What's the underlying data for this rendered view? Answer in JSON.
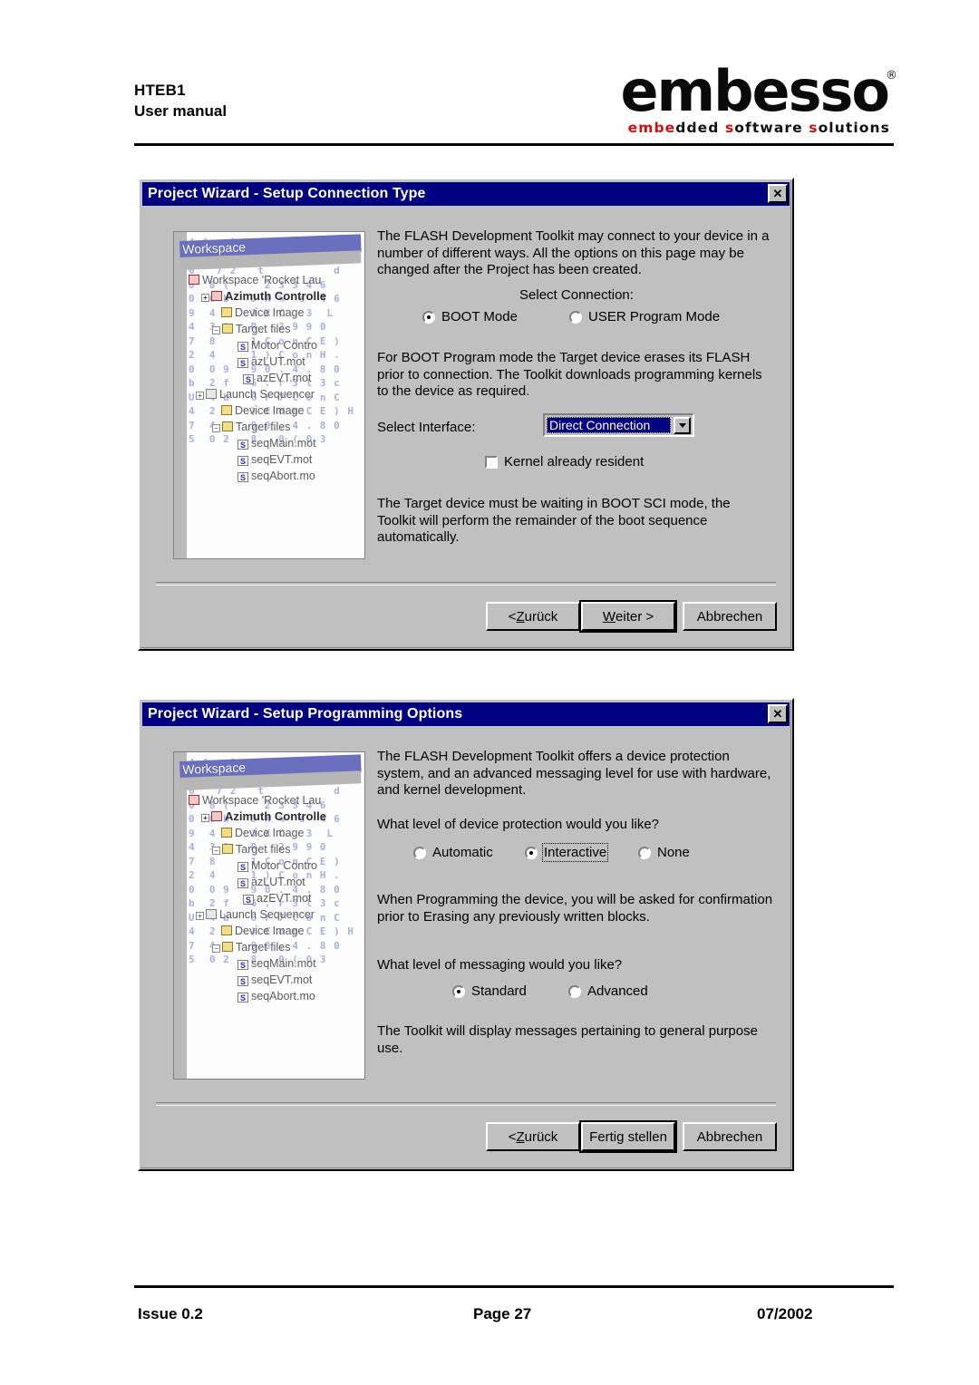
{
  "header": {
    "doc_title": "HTEB1",
    "doc_subtitle": "User manual",
    "logo_word": "embesso",
    "logo_reg": "®",
    "logo_tagline_parts": [
      "embe",
      "dded ",
      "s",
      "oftware ",
      "s",
      "olutions"
    ],
    "logo_tagline": "embedded software solutions"
  },
  "footer": {
    "issue": "Issue 0.2",
    "page": "Page 27",
    "date": "07/2002"
  },
  "dialog1": {
    "title": "Project Wizard - Setup Connection Type",
    "close_label": "✕",
    "intro_text": "The FLASH Development Toolkit may connect to your device in a\nnumber of different ways. All the options on this page may be\nchanged after the Project has been created.",
    "select_connection_label": "Select Connection:",
    "connection_options": [
      {
        "label": "BOOT Mode",
        "checked": true
      },
      {
        "label": "USER Program Mode",
        "checked": false
      }
    ],
    "boot_text": "For BOOT Program mode the Target device erases its FLASH\nprior to connection. The Toolkit downloads programming kernels\nto the device as required.",
    "select_interface_label": "Select Interface:",
    "interface_value": "Direct Connection",
    "kernel_checkbox_label": "Kernel already resident",
    "kernel_checkbox_checked": false,
    "footer_text": "The Target device must be waiting in BOOT SCI mode, the\nToolkit will perform the remainder of the boot sequence\nautomatically.",
    "buttons": {
      "back": {
        "pre": "< ",
        "mnemonic": "Z",
        "post": "urück"
      },
      "next": {
        "pre": "",
        "mnemonic": "W",
        "post": "eiter >"
      },
      "cancel": {
        "pre": "",
        "mnemonic": "",
        "post": "Abbrechen"
      }
    }
  },
  "dialog2": {
    "title": "Project Wizard - Setup Programming Options",
    "close_label": "✕",
    "intro_text": "The FLASH Development Toolkit offers a device protection\nsystem, and an advanced messaging level for use with hardware,\nand kernel development.",
    "protection_question": "What level of device protection would you like?",
    "protection_options": [
      {
        "label": "Automatic",
        "checked": false,
        "focused": false
      },
      {
        "label": "Interactive",
        "checked": true,
        "focused": true
      },
      {
        "label": "None",
        "checked": false,
        "focused": false
      }
    ],
    "protection_note": "When Programming the device, you will be asked for confirmation\nprior to Erasing any previously written blocks.",
    "messaging_question": "What level of messaging would you like?",
    "messaging_options": [
      {
        "label": "Standard",
        "checked": true
      },
      {
        "label": "Advanced",
        "checked": false
      }
    ],
    "messaging_note": "The Toolkit will display messages pertaining to general purpose\nuse.",
    "buttons": {
      "back": {
        "pre": "< ",
        "mnemonic": "Z",
        "post": "urück"
      },
      "finish": {
        "pre": "",
        "mnemonic": "",
        "post": "Fertig stellen"
      },
      "cancel": {
        "pre": "",
        "mnemonic": "",
        "post": "Abbrechen"
      }
    }
  },
  "wizard_bitmap": {
    "window_label": "Workspace",
    "tree": [
      {
        "label": "Workspace 'Rocket Lau",
        "indent": 0,
        "icon": "project-icon",
        "bold": false
      },
      {
        "label": "Azimuth Controlle",
        "indent": 1,
        "icon": "red-project-icon",
        "bold": true
      },
      {
        "label": "Device Image",
        "indent": 2,
        "icon": "folder-icon",
        "bold": false
      },
      {
        "label": "Target files",
        "indent": 2,
        "icon": "folder-icon",
        "bold": false
      },
      {
        "label": "Motor Contro",
        "indent": 3,
        "icon": "source-file-icon",
        "bold": false
      },
      {
        "label": "azLUT.mot",
        "indent": 3,
        "icon": "source-file-icon",
        "bold": false
      },
      {
        "label": "azEVT.mot",
        "indent": 3,
        "icon": "source-file-icon",
        "bold": false
      },
      {
        "label": "Launch Sequencer",
        "indent": 1,
        "icon": "project-icon",
        "bold": false
      },
      {
        "label": "Device Image",
        "indent": 2,
        "icon": "folder-icon",
        "bold": false
      },
      {
        "label": "Target files",
        "indent": 2,
        "icon": "folder-icon",
        "bold": false
      },
      {
        "label": "seqMain.mot",
        "indent": 3,
        "icon": "source-file-icon",
        "bold": false
      },
      {
        "label": "seqEVT.mot",
        "indent": 3,
        "icon": "source-file-icon",
        "bold": false
      },
      {
        "label": "seqAbort.mo",
        "indent": 3,
        "icon": "source-file-icon",
        "bold": false
      }
    ],
    "hex_background": "4 0   1 ) H ( H . B\nn  b  .  c  .  b\n6   7 2   t          d\n0  8 (     2 3 3 4 6\n0  0 b   J X %  s  4 6\n9  4 c   J X C   3  L\n4  3 0   R   2 9 9 0\n7  8     1 C o n C E )\n2  4     1 ) C o n H .\n0  0 9   9 0 . 4 . 8 0\nb  2 f   6 . r 3 l 3 c\nU  4 b   6 r 7 C o n C\n4  2 9   ) C o n C E ) H\n7  4 3   9 0 . 4 . 8 0\n5  0 2   8 . 0 ( 0 3"
  },
  "colors": {
    "titlebar": "#000080",
    "dialog_face": "#c0c0c0",
    "accent_red": "#cc1111",
    "selection": "#000080"
  }
}
